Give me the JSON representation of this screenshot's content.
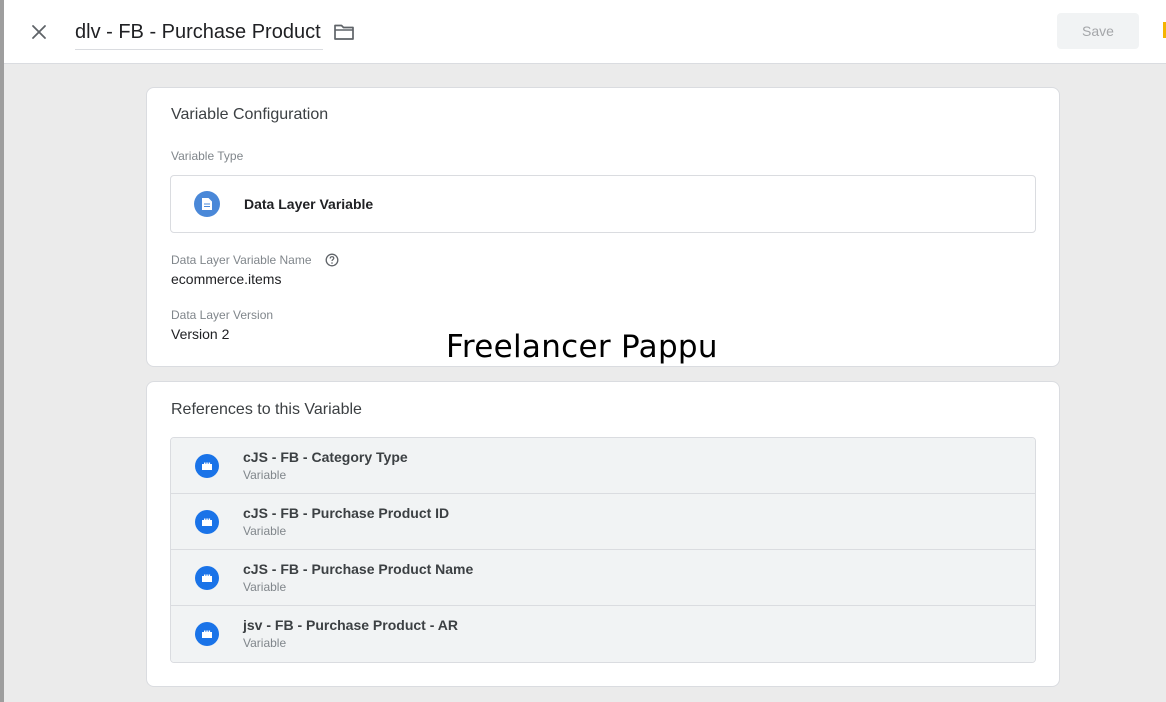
{
  "header": {
    "title": "dlv - FB - Purchase Product",
    "save_label": "Save",
    "close_icon": "close-icon",
    "folder_icon": "folder-icon"
  },
  "config": {
    "heading": "Variable Configuration",
    "type_label": "Variable Type",
    "type_value": "Data Layer Variable",
    "type_icon": "document-icon",
    "name_label": "Data Layer Variable Name",
    "name_value": "ecommerce.items",
    "version_label": "Data Layer Version",
    "version_value": "Version 2"
  },
  "watermark": "Freelancer Pappu",
  "references": {
    "heading": "References to this Variable",
    "items": [
      {
        "name": "cJS - FB - Category Type",
        "type": "Variable"
      },
      {
        "name": "cJS - FB - Purchase Product ID",
        "type": "Variable"
      },
      {
        "name": "cJS - FB - Purchase Product Name",
        "type": "Variable"
      },
      {
        "name": "jsv - FB - Purchase Product - AR",
        "type": "Variable"
      }
    ]
  },
  "colors": {
    "accent_blue": "#1a73e8",
    "type_icon_blue": "#4a88d8",
    "save_disabled_bg": "#f1f3f4"
  }
}
